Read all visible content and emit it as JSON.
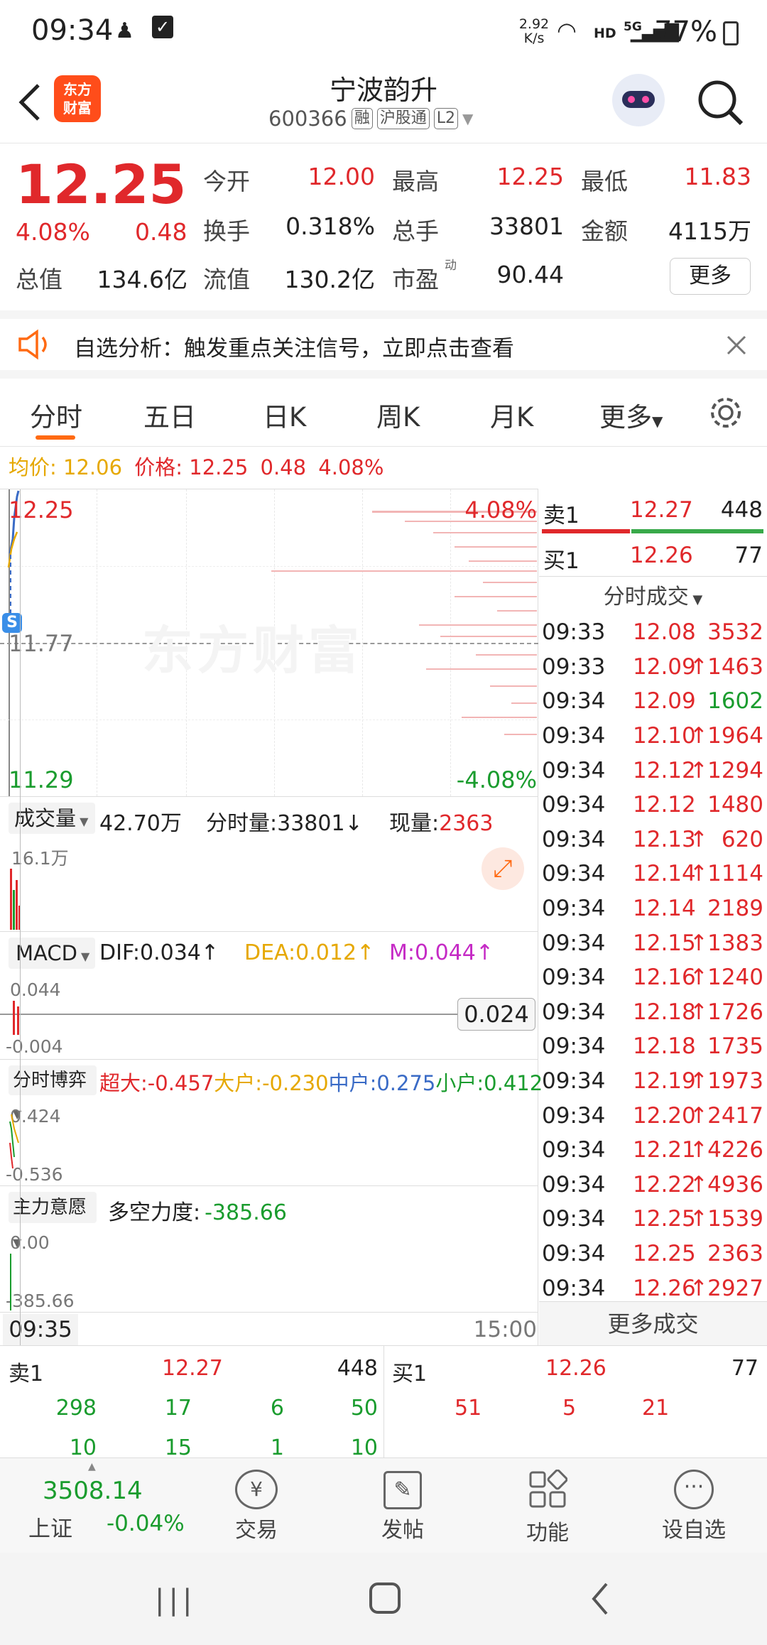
{
  "status_bar": {
    "time": "09:34",
    "net_speed_value": "2.92",
    "net_speed_unit": "K/s",
    "hd": "HD",
    "network": "5G",
    "battery": "77%"
  },
  "header": {
    "logo_line1": "东方",
    "logo_line2": "财富",
    "stock_name": "宁波韵升",
    "stock_code": "600366",
    "tags": [
      "融",
      "沪股通",
      "L2"
    ]
  },
  "quote": {
    "price": "12.25",
    "change_pct": "4.08%",
    "change_amt": "0.48",
    "fields": [
      {
        "label": "今开",
        "value": "12.00"
      },
      {
        "label": "最高",
        "value": "12.25"
      },
      {
        "label": "最低",
        "value": "11.83"
      },
      {
        "label": "换手",
        "value": "0.318%"
      },
      {
        "label": "总手",
        "value": "33801"
      },
      {
        "label": "金额",
        "value": "4115万"
      },
      {
        "label": "总值",
        "value": "134.6亿"
      },
      {
        "label": "流值",
        "value": "130.2亿"
      },
      {
        "label": "市盈",
        "value": "90.44"
      }
    ],
    "pe_superscript": "动",
    "more_label": "更多"
  },
  "notice": {
    "text": "自选分析：触发重点关注信号，立即点击查看"
  },
  "tabs": [
    "分时",
    "五日",
    "日K",
    "周K",
    "月K",
    "更多"
  ],
  "info_line": {
    "avg_label": "均价:",
    "avg_value": "12.06",
    "price_label": "价格:",
    "price_value": "12.25",
    "change_amt": "0.48",
    "change_pct": "4.08%"
  },
  "chart": {
    "price_high": "12.25",
    "price_mid": "11.77",
    "price_low": "11.29",
    "pct_high": "4.08%",
    "pct_low": "-4.08%",
    "watermark": "东方财富",
    "s_badge": "S",
    "volume_selector": "成交量",
    "volume_value": "42.70万",
    "minute_volume_label": "分时量:",
    "minute_volume": "33801",
    "current_volume_label": "现量:",
    "current_volume": "2363",
    "volume_axis": "16.1万",
    "macd_selector": "MACD",
    "dif": "DIF:0.034",
    "dea": "DEA:0.012",
    "m": "M:0.044",
    "macd_axis_top": "0.044",
    "macd_axis_bottom": "-0.004",
    "macd_marker": "0.024",
    "flow_selector": "分时博弈",
    "super_label": "超大:",
    "super_value": "-0.457",
    "large_label": "大户:",
    "large_value": "-0.230",
    "medium_label": "中户:",
    "medium_value": "0.275",
    "small_label": "小户:",
    "small_value": "0.412",
    "flow_axis_top": "0.424",
    "flow_axis_bottom": "-0.536",
    "intent_selector": "主力意愿",
    "power_label": "多空力度:",
    "power_value": "-385.66",
    "intent_axis_top": "0.00",
    "intent_axis_bottom": "-385.66",
    "time_start": "09:35",
    "time_end": "15:00"
  },
  "order_book": {
    "sell1_label": "卖1",
    "sell1_price": "12.27",
    "sell1_vol": "448",
    "buy1_label": "买1",
    "buy1_price": "12.26",
    "buy1_vol": "77",
    "ticks_title": "分时成交",
    "more_trades": "更多成交"
  },
  "ticks": [
    {
      "time": "09:33",
      "price": "12.08",
      "arrow": "",
      "vol": "3532",
      "color": "red"
    },
    {
      "time": "09:33",
      "price": "12.09",
      "arrow": "↑",
      "vol": "1463",
      "color": "red"
    },
    {
      "time": "09:34",
      "price": "12.09",
      "arrow": "",
      "vol": "1602",
      "color": "green"
    },
    {
      "time": "09:34",
      "price": "12.10",
      "arrow": "↑",
      "vol": "1964",
      "color": "red"
    },
    {
      "time": "09:34",
      "price": "12.12",
      "arrow": "↑",
      "vol": "1294",
      "color": "red"
    },
    {
      "time": "09:34",
      "price": "12.12",
      "arrow": "",
      "vol": "1480",
      "color": "red"
    },
    {
      "time": "09:34",
      "price": "12.13",
      "arrow": "↑",
      "vol": "620",
      "color": "red"
    },
    {
      "time": "09:34",
      "price": "12.14",
      "arrow": "↑",
      "vol": "1114",
      "color": "red"
    },
    {
      "time": "09:34",
      "price": "12.14",
      "arrow": "",
      "vol": "2189",
      "color": "red"
    },
    {
      "time": "09:34",
      "price": "12.15",
      "arrow": "↑",
      "vol": "1383",
      "color": "red"
    },
    {
      "time": "09:34",
      "price": "12.16",
      "arrow": "↑",
      "vol": "1240",
      "color": "red"
    },
    {
      "time": "09:34",
      "price": "12.18",
      "arrow": "↑",
      "vol": "1726",
      "color": "red"
    },
    {
      "time": "09:34",
      "price": "12.18",
      "arrow": "",
      "vol": "1735",
      "color": "red"
    },
    {
      "time": "09:34",
      "price": "12.19",
      "arrow": "↑",
      "vol": "1973",
      "color": "red"
    },
    {
      "time": "09:34",
      "price": "12.20",
      "arrow": "↑",
      "vol": "2417",
      "color": "red"
    },
    {
      "time": "09:34",
      "price": "12.21",
      "arrow": "↑",
      "vol": "4226",
      "color": "red"
    },
    {
      "time": "09:34",
      "price": "12.22",
      "arrow": "↑",
      "vol": "4936",
      "color": "red"
    },
    {
      "time": "09:34",
      "price": "12.25",
      "arrow": "↑",
      "vol": "1539",
      "color": "red"
    },
    {
      "time": "09:34",
      "price": "12.25",
      "arrow": "",
      "vol": "2363",
      "color": "red"
    },
    {
      "time": "09:34",
      "price": "12.26",
      "arrow": "↑",
      "vol": "2927",
      "color": "red"
    }
  ],
  "bottom_book": {
    "sell_label": "卖1",
    "sell_price": "12.27",
    "sell_vol": "448",
    "buy_label": "买1",
    "buy_price": "12.26",
    "buy_vol": "77",
    "sell_row1": [
      "298",
      "17",
      "6",
      "50"
    ],
    "sell_row2": [
      "10",
      "15",
      "1",
      "10"
    ],
    "buy_row1": [
      "51",
      "5",
      "21"
    ]
  },
  "nav": {
    "index_value": "3508.14",
    "index_name": "上证",
    "index_change": "-0.04%",
    "items": [
      "交易",
      "发帖",
      "功能",
      "设自选"
    ]
  }
}
